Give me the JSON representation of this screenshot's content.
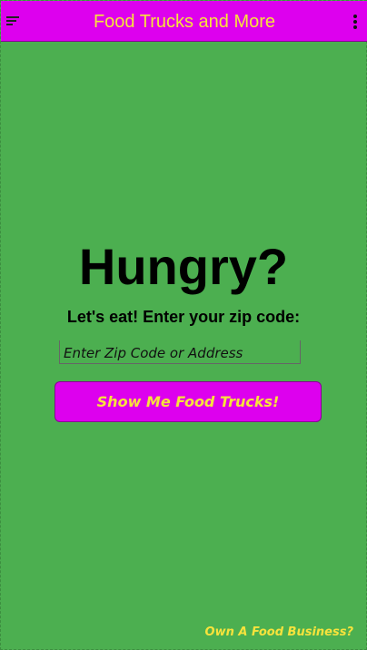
{
  "app": {
    "title": "Food Trucks and More"
  },
  "icons": {
    "menu": "menu-icon",
    "more": "more-vertical-icon"
  },
  "hero": {
    "headline": "Hungry?",
    "subheadline": "Let's eat! Enter your zip code:"
  },
  "search": {
    "placeholder": "Enter Zip Code or Address",
    "value": ""
  },
  "actions": {
    "show_trucks_label": "Show Me Food Trucks!"
  },
  "footer": {
    "business_link": "Own A Food Business?"
  },
  "colors": {
    "background": "#4caf50",
    "accent": "#dd00ee",
    "text_highlight": "#f7e33c"
  }
}
